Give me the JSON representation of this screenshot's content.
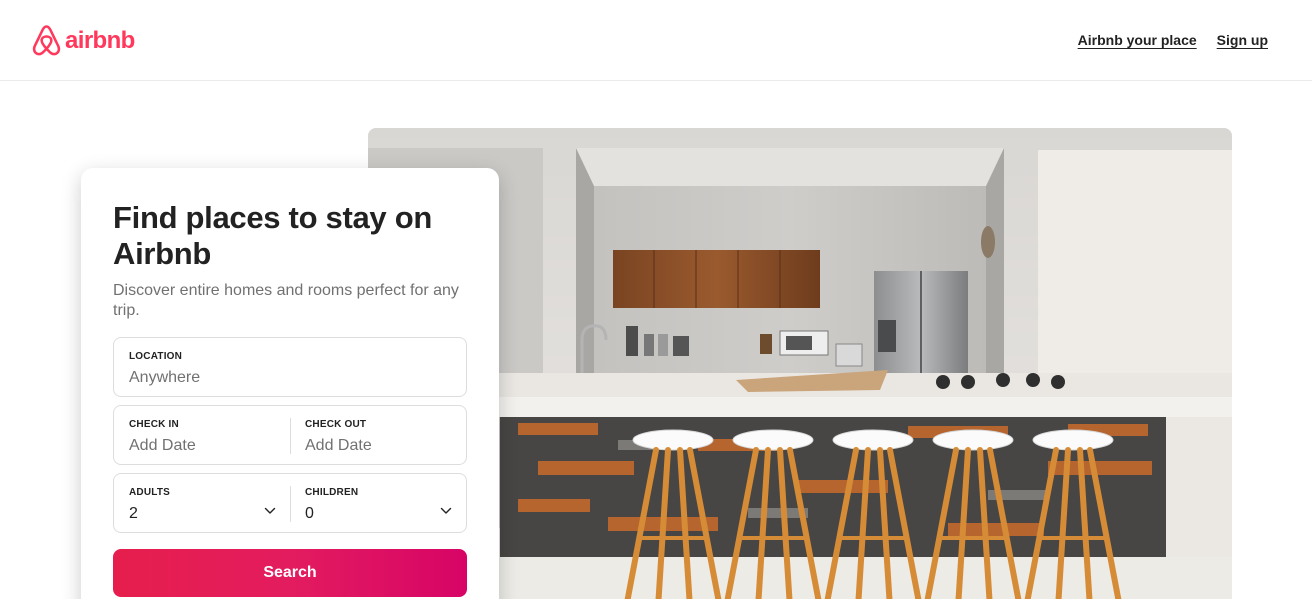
{
  "brand": {
    "name": "airbnb",
    "accent": "#FF385C"
  },
  "header": {
    "nav": {
      "host_label": "Airbnb your place",
      "signup_label": "Sign up"
    }
  },
  "search": {
    "title": "Find places to stay on Airbnb",
    "subtitle": "Discover entire homes and rooms perfect for any trip.",
    "location": {
      "label": "LOCATION",
      "placeholder": "Anywhere"
    },
    "check_in": {
      "label": "CHECK IN",
      "placeholder": "Add Date"
    },
    "check_out": {
      "label": "CHECK OUT",
      "placeholder": "Add Date"
    },
    "adults": {
      "label": "ADULTS",
      "value": "2",
      "icon": "chevron-down-icon"
    },
    "children": {
      "label": "CHILDREN",
      "value": "0",
      "icon": "chevron-down-icon"
    },
    "button_label": "Search",
    "button_colors": [
      "#E61E4D",
      "#D70466"
    ]
  }
}
